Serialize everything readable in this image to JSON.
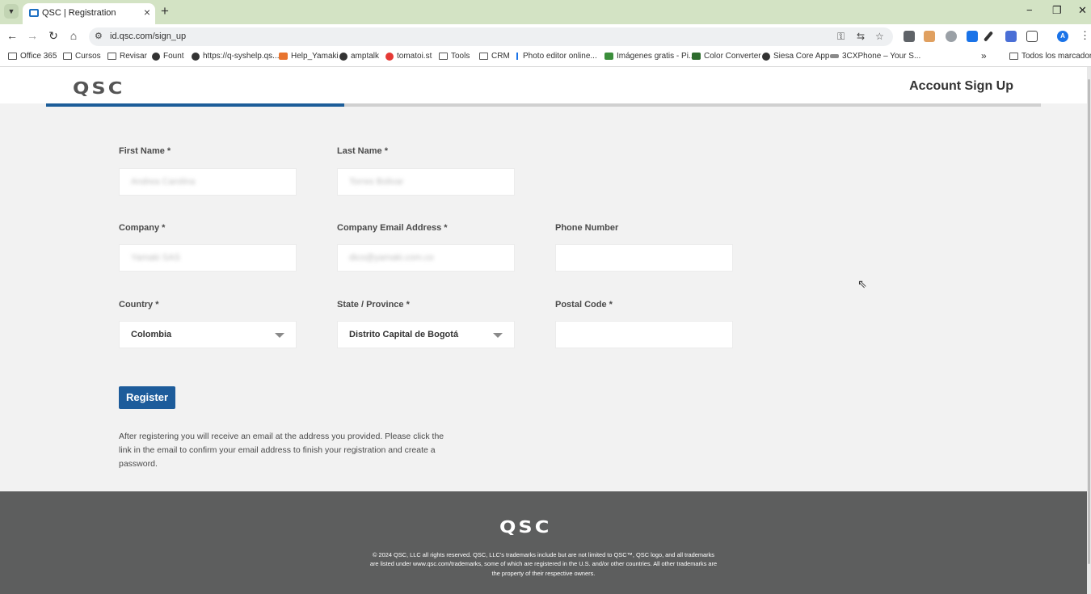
{
  "browser": {
    "tab_title": "QSC | Registration",
    "url": "id.qsc.com/sign_up",
    "new_tab": "+",
    "tab_close": "×",
    "minimize": "−",
    "restore": "❐",
    "close": "✕",
    "bookmarks": [
      {
        "label": "Office 365",
        "icon": "folder-icon"
      },
      {
        "label": "Cursos",
        "icon": "folder-icon"
      },
      {
        "label": "Revisar",
        "icon": "folder-icon"
      },
      {
        "label": "Fount",
        "icon": "globe-icon"
      },
      {
        "label": "https://q-syshelp.qs...",
        "icon": "globe-icon"
      },
      {
        "label": "Help_Yamaki",
        "icon": "app-icon"
      },
      {
        "label": "amptalk",
        "icon": "globe-icon"
      },
      {
        "label": "tomatoi.st",
        "icon": "tomato-icon"
      },
      {
        "label": "Tools",
        "icon": "folder-icon"
      },
      {
        "label": "CRM",
        "icon": "folder-icon"
      },
      {
        "label": "Photo editor online...",
        "icon": "pin-icon"
      },
      {
        "label": "Imágenes gratis - Pi...",
        "icon": "app-icon"
      },
      {
        "label": "Color Converter",
        "icon": "w-icon"
      },
      {
        "label": "Siesa Core App",
        "icon": "globe-icon"
      },
      {
        "label": "3CXPhone – Your S...",
        "icon": "app-icon"
      }
    ],
    "all_bookmarks": "Todos los marcadores",
    "profile_initial": "A"
  },
  "header": {
    "logo_text": "QSC",
    "title": "Account Sign Up",
    "progress": 0.3
  },
  "form": {
    "first_name": {
      "label": "First Name *",
      "value": "Andrea Carolina"
    },
    "last_name": {
      "label": "Last Name *",
      "value": "Torres Bolivar"
    },
    "company": {
      "label": "Company *",
      "value": "Yamaki SAS"
    },
    "email": {
      "label": "Company Email Address *",
      "value": "dico@yamaki.com.co"
    },
    "phone": {
      "label": "Phone Number",
      "value": ""
    },
    "country": {
      "label": "Country *",
      "value": "Colombia"
    },
    "state": {
      "label": "State / Province *",
      "value": "Distrito Capital de Bogotá"
    },
    "postal": {
      "label": "Postal Code *",
      "value": ""
    },
    "register_label": "Register",
    "help_text": "After registering you will receive an email at the address you provided. Please click the link in the email to confirm your email address to finish your registration and create a password."
  },
  "footer": {
    "logo_text": "QSC",
    "legal": "© 2024 QSC, LLC all rights reserved. QSC, LLC's trademarks include but are not limited to QSC™, QSC logo, and all trademarks are listed under www.qsc.com/trademarks, some of which are registered in the U.S. and/or other countries. All other trademarks are the property of their respective owners."
  },
  "colors": {
    "accent": "#1d5c9b",
    "tabstrip": "#d3e3c4",
    "footer": "#5d5e5e"
  }
}
